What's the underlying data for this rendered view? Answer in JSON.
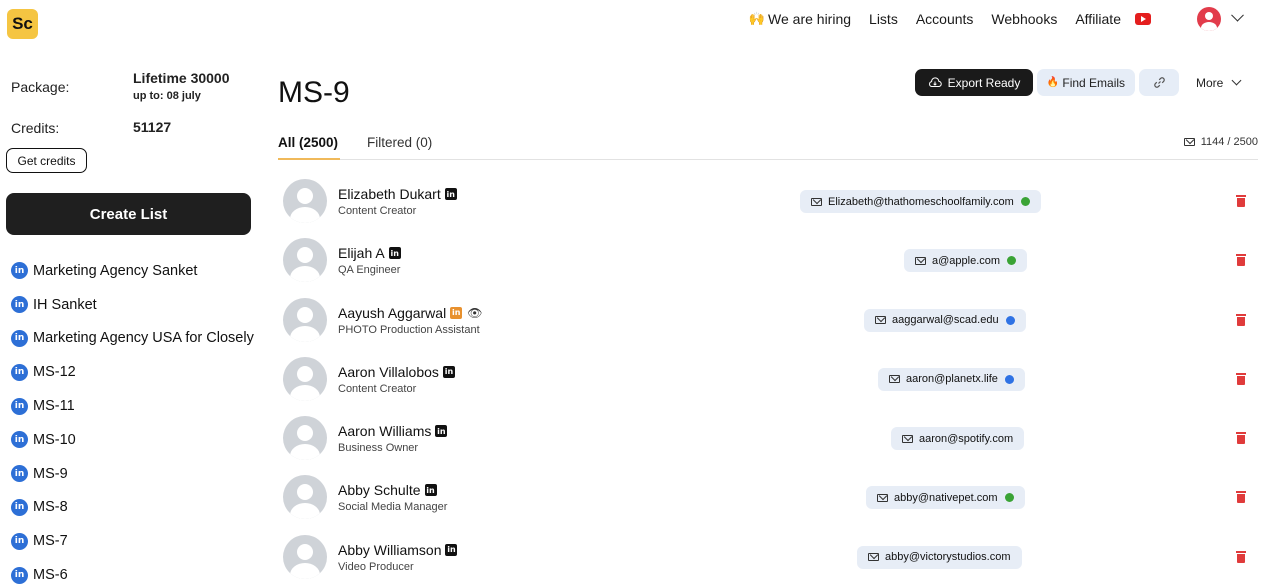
{
  "brand": {
    "logo_text": "Sc"
  },
  "topnav": {
    "hiring": "We are hiring",
    "hiring_emoji": "🙌",
    "links": [
      "Lists",
      "Accounts",
      "Webhooks",
      "Affiliate"
    ],
    "youtube_icon": "youtube-icon",
    "user_icon": "user-avatar-icon"
  },
  "sidebar": {
    "package_label": "Package:",
    "package_value": "Lifetime 30000",
    "package_sub": "up to: 08 july",
    "credits_label": "Credits:",
    "credits_value": "51127",
    "get_credits": "Get credits",
    "create_list": "Create List",
    "lists": [
      "Marketing Agency Sanket",
      "IH Sanket",
      "Marketing Agency USA for Closely",
      "MS-12",
      "MS-11",
      "MS-10",
      "MS-9",
      "MS-8",
      "MS-7",
      "MS-6"
    ]
  },
  "main": {
    "title": "MS-9",
    "export_label": "Export Ready",
    "find_label": "Find Emails",
    "find_emoji": "🔥",
    "more_label": "More",
    "tabs": [
      "All (2500)",
      "Filtered (0)"
    ],
    "counter": "1144 / 2500"
  },
  "colors": {
    "green": "#3aa335",
    "blue": "#2f72e4",
    "accent": "#f0b95a",
    "delete": "#e03b3b"
  },
  "contacts": [
    {
      "name": "Elizabeth Dukart",
      "title": "Content Creator",
      "email": "Elizabeth@thathomeschoolfamily.com",
      "status": "green",
      "linkedin": "black",
      "eye": false
    },
    {
      "name": "Elijah A",
      "title": "QA Engineer",
      "email": "a@apple.com",
      "status": "green",
      "linkedin": "black",
      "eye": false
    },
    {
      "name": "Aayush Aggarwal",
      "title": "PHOTO Production Assistant",
      "email": "aaggarwal@scad.edu",
      "status": "blue",
      "linkedin": "orange",
      "eye": true
    },
    {
      "name": "Aaron Villalobos",
      "title": "Content Creator",
      "email": "aaron@planetx.life",
      "status": "blue",
      "linkedin": "black",
      "eye": false
    },
    {
      "name": "Aaron Williams",
      "title": "Business Owner",
      "email": "aaron@spotify.com",
      "status": "none",
      "linkedin": "black",
      "eye": false
    },
    {
      "name": "Abby Schulte",
      "title": "Social Media Manager",
      "email": "abby@nativepet.com",
      "status": "green",
      "linkedin": "black",
      "eye": false
    },
    {
      "name": "Abby Williamson",
      "title": "Video Producer",
      "email": "abby@victorystudios.com",
      "status": "none",
      "linkedin": "black",
      "eye": false
    }
  ]
}
